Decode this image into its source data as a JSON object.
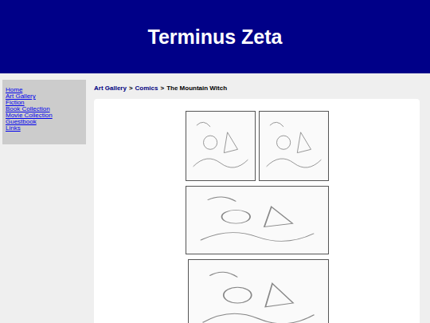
{
  "site": {
    "title": "Terminus Zeta"
  },
  "sidebar": {
    "items": [
      "Home",
      "Art Gallery",
      "Fiction",
      "Book Collection",
      "Movie Collection",
      "Guestbook",
      "Links"
    ]
  },
  "breadcrumb": {
    "links": [
      "Art Gallery",
      "Comics"
    ],
    "separator": ">",
    "current": "The Mountain Witch"
  }
}
